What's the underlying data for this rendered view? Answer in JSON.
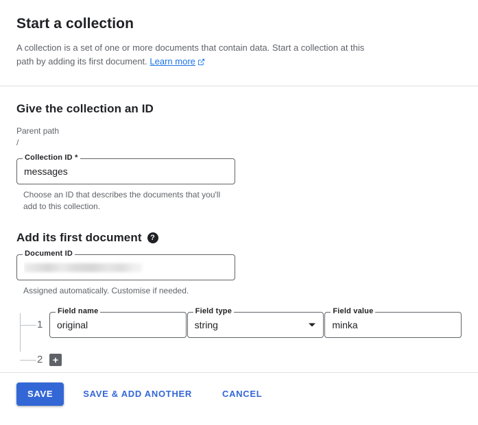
{
  "header": {
    "title": "Start a collection",
    "description_part1": "A collection is a set of one or more documents that contain data. Start a collection at this path by adding its first document.",
    "learn_more_label": "Learn more",
    "external_link_icon": "external-link-icon"
  },
  "collection_section": {
    "title": "Give the collection an ID",
    "parent_path_label": "Parent path",
    "parent_path_value": "/",
    "collection_id_label": "Collection ID *",
    "collection_id_value": "messages",
    "collection_id_placeholder": "Collection ID",
    "helper_text": "Choose an ID that describes the documents that you'll add to this collection."
  },
  "document_section": {
    "title": "Add its first document",
    "help_icon": "help-icon",
    "help_glyph": "?",
    "document_id_label": "Document ID",
    "document_id_value": "",
    "document_id_redacted": true,
    "helper_text": "Assigned automatically. Customise if needed."
  },
  "fields": {
    "labels": {
      "name": "Field name",
      "type": "Field type",
      "value": "Field value"
    },
    "rows": [
      {
        "index": "1",
        "name": "original",
        "type": "string",
        "value": "minka"
      }
    ],
    "add_row_index": "2",
    "add_button_glyph": "+",
    "add_button_icon": "plus-icon"
  },
  "footer": {
    "save_label": "SAVE",
    "save_add_another_label": "SAVE & ADD ANOTHER",
    "cancel_label": "CANCEL"
  },
  "colors": {
    "accent": "#3367d6",
    "link": "#1a73e8",
    "text_primary": "#202124",
    "text_secondary": "#5f6368",
    "divider": "#e0e0e0",
    "field_border": "#5f6368",
    "add_button_bg": "#5f6368"
  }
}
